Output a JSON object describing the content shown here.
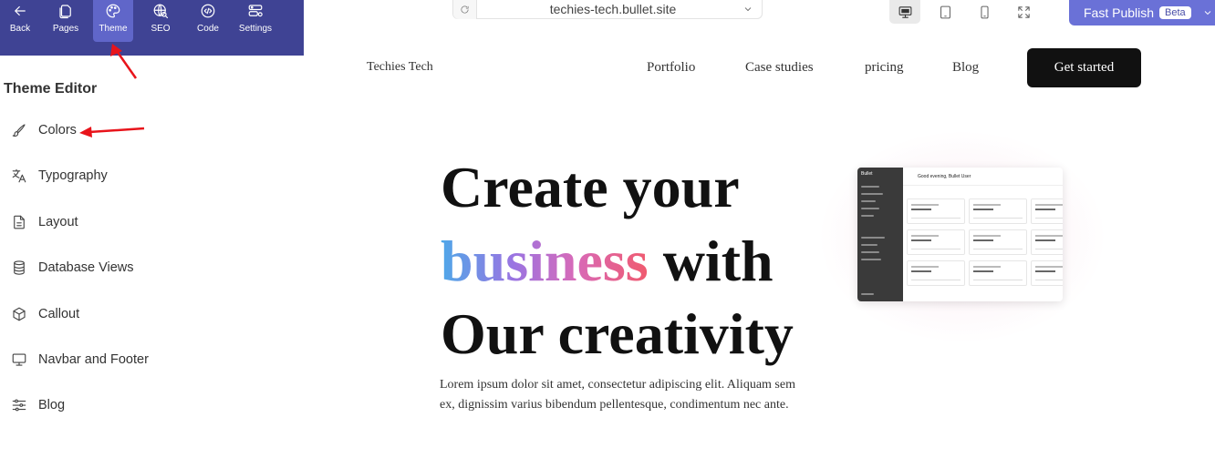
{
  "toolbar": {
    "items": [
      {
        "label": "Back",
        "icon": "arrow-left-icon"
      },
      {
        "label": "Pages",
        "icon": "pages-icon"
      },
      {
        "label": "Theme",
        "icon": "palette-icon",
        "active": true
      },
      {
        "label": "SEO",
        "icon": "globe-search-icon"
      },
      {
        "label": "Code",
        "icon": "code-icon"
      },
      {
        "label": "Settings",
        "icon": "settings-sliders-icon"
      }
    ]
  },
  "sidebar": {
    "title": "Theme Editor",
    "items": [
      {
        "label": "Colors",
        "icon": "brush-icon"
      },
      {
        "label": "Typography",
        "icon": "translate-icon"
      },
      {
        "label": "Layout",
        "icon": "document-icon"
      },
      {
        "label": "Database Views",
        "icon": "database-icon"
      },
      {
        "label": "Callout",
        "icon": "cube-icon"
      },
      {
        "label": "Navbar and Footer",
        "icon": "monitor-icon"
      },
      {
        "label": "Blog",
        "icon": "sliders-icon"
      }
    ]
  },
  "browser": {
    "url": "techies-tech.bullet.site",
    "devices": [
      "desktop-icon",
      "tablet-icon",
      "mobile-icon",
      "fullscreen-icon"
    ],
    "publish_label": "Fast Publish",
    "beta_label": "Beta"
  },
  "site": {
    "brand": "Techies Tech",
    "nav": [
      "Portfolio",
      "Case studies",
      "pricing",
      "Blog"
    ],
    "cta": "Get started",
    "hero": {
      "line1": "Create your",
      "line2_highlight": "business",
      "line2_rest": " with",
      "line3": "Our creativity",
      "paragraph": "Lorem ipsum dolor sit amet, consectetur adipiscing elit. Aliquam sem ex, dignissim  varius bibendum pellentesque, condimentum nec ante."
    },
    "mockup": {
      "brand": "Bullet",
      "greeting": "Good evening, Bullet User"
    }
  },
  "colors": {
    "toolbar_bg": "#3f4394",
    "toolbar_active": "#6066c9",
    "publish_bg": "#6a71d7",
    "cta_bg": "#111111",
    "annotation_arrow": "#e8141b"
  }
}
